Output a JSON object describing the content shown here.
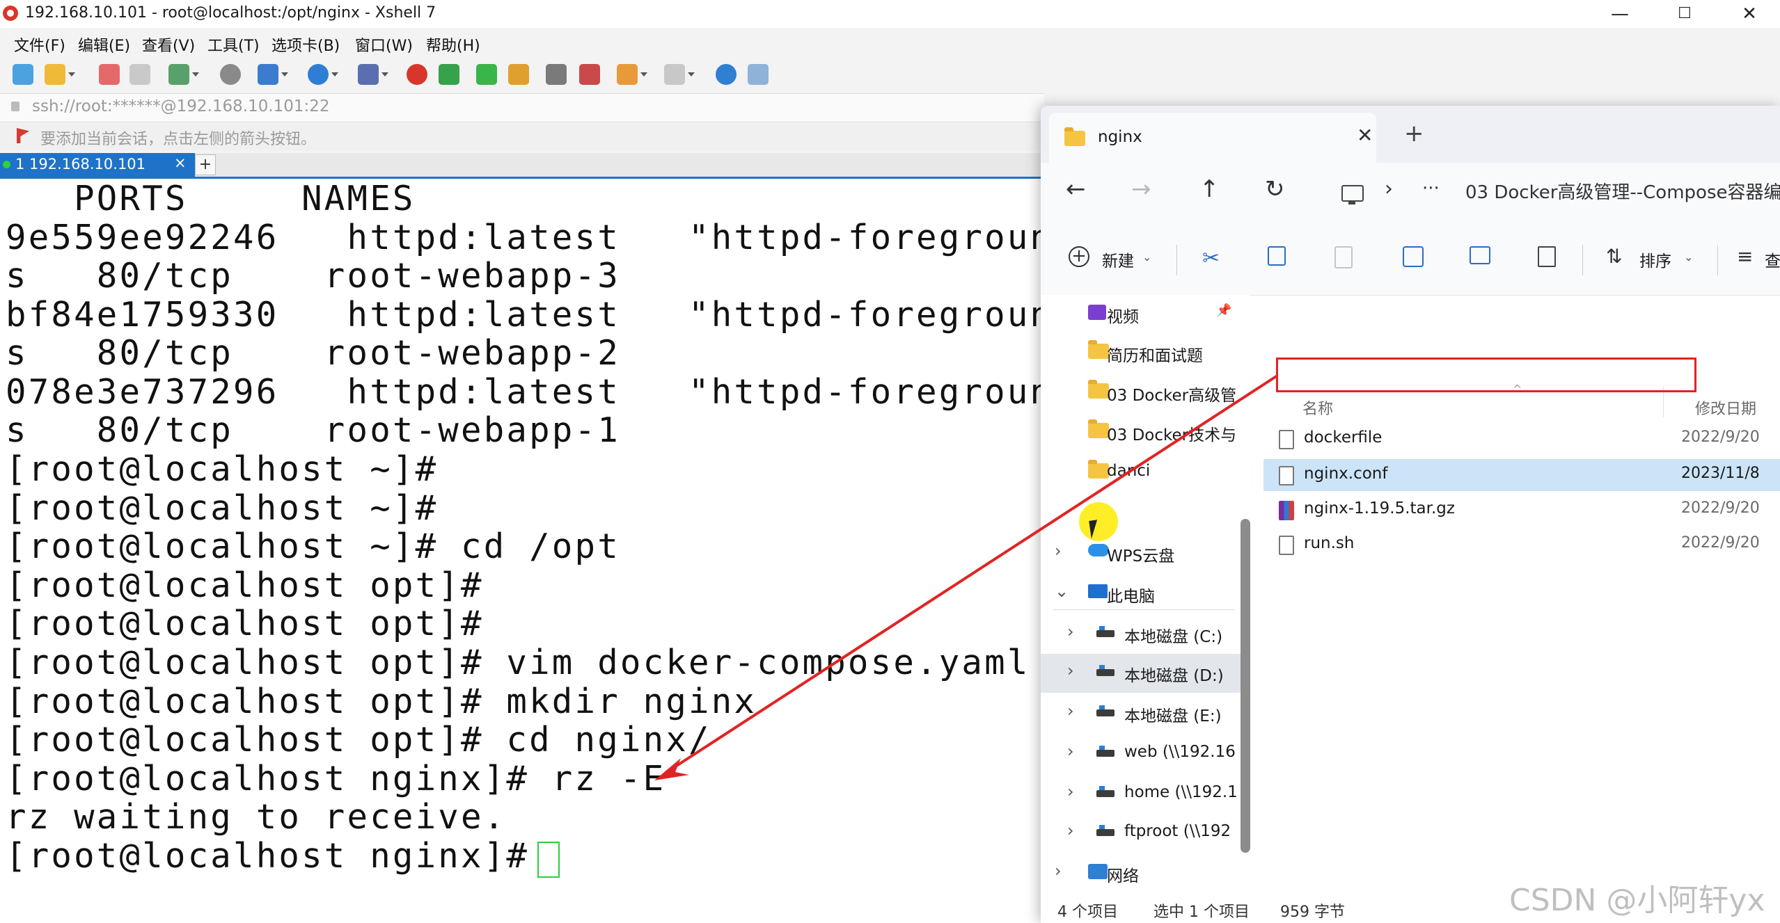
{
  "xshell": {
    "title": "192.168.10.101 - root@localhost:/opt/nginx - Xshell 7",
    "window_buttons": {
      "minimize": "—",
      "maximize": "☐",
      "close": "✕"
    },
    "menu": [
      "文件(F)",
      "编辑(E)",
      "查看(V)",
      "工具(T)",
      "选项卡(B)",
      "窗口(W)",
      "帮助(H)"
    ],
    "address": "ssh://root:******@192.168.10.101:22",
    "hint": "要添加当前会话，点击左侧的箭头按钮。",
    "tab": {
      "label": "1 192.168.10.101",
      "close": "×",
      "add": "+"
    },
    "terminal_lines": [
      "   PORTS     NAMES",
      "9e559ee92246   httpd:latest   \"httpd-foreground",
      "s   80/tcp    root-webapp-3",
      "bf84e1759330   httpd:latest   \"httpd-foreground",
      "s   80/tcp    root-webapp-2",
      "078e3e737296   httpd:latest   \"httpd-foreground",
      "s   80/tcp    root-webapp-1",
      "[root@localhost ~]#",
      "[root@localhost ~]#",
      "[root@localhost ~]# cd /opt",
      "[root@localhost opt]#",
      "[root@localhost opt]#",
      "[root@localhost opt]# vim docker-compose.yaml",
      "[root@localhost opt]# mkdir nginx",
      "[root@localhost opt]# cd nginx/",
      "[root@localhost nginx]# rz -E",
      "rz waiting to receive.",
      "[root@localhost nginx]# "
    ]
  },
  "explorer": {
    "tab_title": "nginx",
    "tab_close": "✕",
    "new_tab": "+",
    "nav": {
      "back": "←",
      "forward": "→",
      "up": "↑",
      "refresh": "↻",
      "chevron": "›",
      "more": "···"
    },
    "path": "03 Docker高级管理--Compose容器编",
    "cmd": {
      "new_label": "新建",
      "sort_label": "排序",
      "view_label": "查"
    },
    "nav_items": [
      {
        "label": "视频",
        "icon": "video-icon",
        "chevron": ""
      },
      {
        "label": "简历和面试题",
        "icon": "folder-icon",
        "chevron": ""
      },
      {
        "label": "03 Docker高级管",
        "icon": "folder-icon",
        "chevron": ""
      },
      {
        "label": "03 Docker技术与",
        "icon": "folder-icon",
        "chevron": ""
      },
      {
        "label": "danci",
        "icon": "folder-icon",
        "chevron": ""
      },
      {
        "label": "WPS云盘",
        "icon": "cloud-icon",
        "chevron": "›"
      },
      {
        "label": "此电脑",
        "icon": "computer-icon",
        "chevron": "⌄"
      },
      {
        "label": "本地磁盘 (C:)",
        "icon": "drive-icon",
        "chevron": "›"
      },
      {
        "label": "本地磁盘 (D:)",
        "icon": "drive-icon",
        "chevron": "›"
      },
      {
        "label": "本地磁盘 (E:)",
        "icon": "drive-icon",
        "chevron": "›"
      },
      {
        "label": "web (\\\\192.16",
        "icon": "network-drive-icon",
        "chevron": "›"
      },
      {
        "label": "home (\\\\192.1",
        "icon": "network-drive-icon",
        "chevron": "›"
      },
      {
        "label": "ftproot (\\\\192",
        "icon": "network-drive-icon",
        "chevron": "›"
      },
      {
        "label": "网络",
        "icon": "network-icon",
        "chevron": "›"
      }
    ],
    "columns": {
      "name": "名称",
      "date": "修改日期"
    },
    "files": [
      {
        "name": "dockerfile",
        "date": "2022/9/20"
      },
      {
        "name": "nginx.conf",
        "date": "2023/11/8"
      },
      {
        "name": "nginx-1.19.5.tar.gz",
        "date": "2022/9/20"
      },
      {
        "name": "run.sh",
        "date": "2022/9/20"
      }
    ],
    "status": {
      "count": "4 个项目",
      "selected": "选中 1 个项目",
      "size": "959 字节"
    }
  },
  "watermark": "CSDN @小阿轩yx",
  "colors": {
    "accent": "#1e73c8",
    "highlight_red": "#e02424",
    "cursor_green": "#2ecc40",
    "selection": "#cce4f7"
  }
}
